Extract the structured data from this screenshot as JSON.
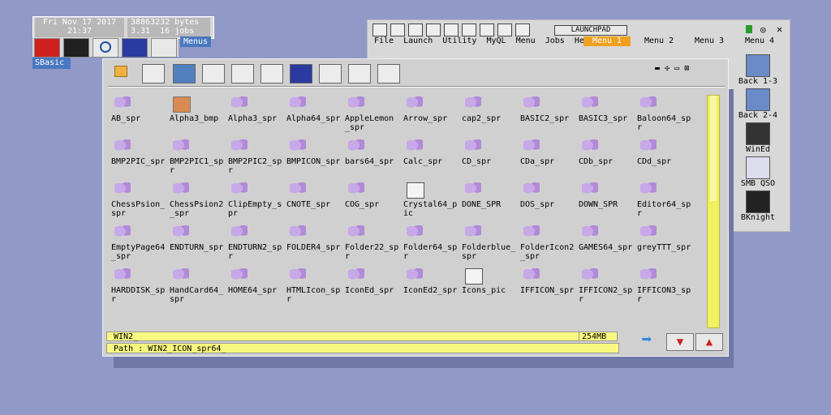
{
  "status": {
    "date": "Fri Nov 17 2017",
    "time": "21:37",
    "bytes": "38863232 bytes",
    "version": "3.31",
    "jobs": "16 jobs"
  },
  "menus_label": "Menus",
  "sbasic_label": "SBasic",
  "launchpad": {
    "title": "LAUNCHPAD",
    "menubar": [
      "File",
      "Launch",
      "Utility",
      "MyQL",
      "Menu",
      "Jobs",
      "Help"
    ],
    "tabs": [
      "Menu 1",
      "Menu 2",
      "Menu 3",
      "Menu 4"
    ],
    "active_tab": "Menu 1",
    "right_items": [
      "Back 1-3",
      "Back 2-4",
      "WinEd",
      "SMB QSO",
      "BKnight"
    ]
  },
  "files": [
    "AB_spr",
    "Alpha3_bmp",
    "Alpha3_spr",
    "Alpha64_spr",
    "AppleLemon\n_spr",
    "Arrow_spr",
    "cap2_spr",
    "BASIC2_spr",
    "BASIC3_spr",
    "Baloon64_sp\nr",
    "BMP2PIC_spr",
    "BMP2PIC1_sp\nr",
    "BMP2PIC2_sp\nr",
    "BMPICON_spr",
    "bars64_spr",
    "Calc_spr",
    "CD_spr",
    "CDa_spr",
    "CDb_spr",
    "CDd_spr",
    "ChessPsion_\nspr",
    "ChessPsion2\n_spr",
    "ClipEmpty_s\npr",
    "CNOTE_spr",
    "COG_spr",
    "Crystal64_p\nic",
    "DONE_SPR",
    "DOS_spr",
    "DOWN_SPR",
    "Editor64_sp\nr",
    "EmptyPage64\n_spr",
    "ENDTURN_spr",
    "ENDTURN2_sp\nr",
    "FOLDER4_spr",
    "Folder22_sp\nr",
    "Folder64_sp\nr",
    "Folderblue_\nspr",
    "FolderIcon2\n_spr",
    "GAMES64_spr",
    "greyTTT_spr",
    "HARDDISK_sp\nr",
    "HandCard64_\nspr",
    "HOME64_spr",
    "HTMLIcon_sp\nr",
    "IconEd_spr",
    "IconEd2_spr",
    "Icons_pic",
    "IFFICON_spr",
    "IFFICON2_sp\nr",
    "IFFICON3_sp\nr"
  ],
  "statusbar": {
    "name": "WIN2_",
    "size": "254MB",
    "path": "Path : WIN2_ICON_spr64_"
  },
  "colors": {
    "desktop": "#9199c8",
    "window": "#d0d0d0",
    "highlight": "#f8f880",
    "accent": "#4a78c0"
  }
}
